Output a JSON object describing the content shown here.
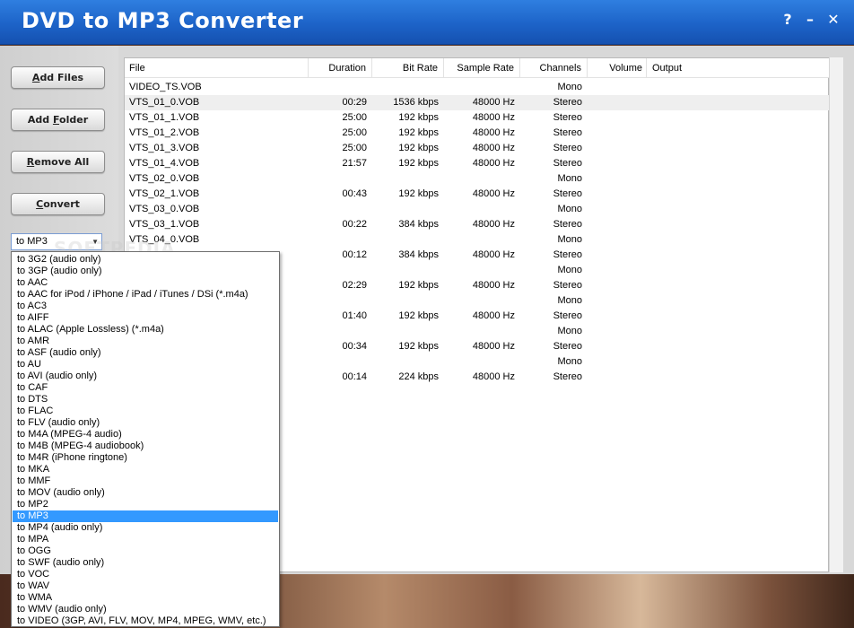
{
  "window": {
    "title": "DVD to MP3 Converter",
    "help_btn": "?",
    "min_btn": "–",
    "close_btn": "✕"
  },
  "sidebar": {
    "add_files_pre": "",
    "add_files_u": "A",
    "add_files_post": "dd Files",
    "add_folder_pre": "Add ",
    "add_folder_u": "F",
    "add_folder_post": "older",
    "remove_all_pre": "",
    "remove_all_u": "R",
    "remove_all_post": "emove All",
    "convert_pre": "",
    "convert_u": "C",
    "convert_post": "onvert",
    "format_value": "to MP3"
  },
  "watermark": "SOFTPEDIA",
  "table": {
    "headers": [
      "File",
      "Duration",
      "Bit Rate",
      "Sample Rate",
      "Channels",
      "Volume",
      "Output"
    ],
    "rows": [
      {
        "file": "VIDEO_TS.VOB",
        "duration": "",
        "bitrate": "",
        "samplerate": "",
        "channels": "Mono"
      },
      {
        "file": "VTS_01_0.VOB",
        "duration": "00:29",
        "bitrate": "1536 kbps",
        "samplerate": "48000 Hz",
        "channels": "Stereo"
      },
      {
        "file": "VTS_01_1.VOB",
        "duration": "25:00",
        "bitrate": "192 kbps",
        "samplerate": "48000 Hz",
        "channels": "Stereo"
      },
      {
        "file": "VTS_01_2.VOB",
        "duration": "25:00",
        "bitrate": "192 kbps",
        "samplerate": "48000 Hz",
        "channels": "Stereo"
      },
      {
        "file": "VTS_01_3.VOB",
        "duration": "25:00",
        "bitrate": "192 kbps",
        "samplerate": "48000 Hz",
        "channels": "Stereo"
      },
      {
        "file": "VTS_01_4.VOB",
        "duration": "21:57",
        "bitrate": "192 kbps",
        "samplerate": "48000 Hz",
        "channels": "Stereo"
      },
      {
        "file": "VTS_02_0.VOB",
        "duration": "",
        "bitrate": "",
        "samplerate": "",
        "channels": "Mono"
      },
      {
        "file": "VTS_02_1.VOB",
        "duration": "00:43",
        "bitrate": "192 kbps",
        "samplerate": "48000 Hz",
        "channels": "Stereo"
      },
      {
        "file": "VTS_03_0.VOB",
        "duration": "",
        "bitrate": "",
        "samplerate": "",
        "channels": "Mono"
      },
      {
        "file": "VTS_03_1.VOB",
        "duration": "00:22",
        "bitrate": "384 kbps",
        "samplerate": "48000 Hz",
        "channels": "Stereo"
      },
      {
        "file": "VTS_04_0.VOB",
        "duration": "",
        "bitrate": "",
        "samplerate": "",
        "channels": "Mono"
      },
      {
        "file": "",
        "duration": "00:12",
        "bitrate": "384 kbps",
        "samplerate": "48000 Hz",
        "channels": "Stereo"
      },
      {
        "file": "",
        "duration": "",
        "bitrate": "",
        "samplerate": "",
        "channels": "Mono"
      },
      {
        "file": "",
        "duration": "02:29",
        "bitrate": "192 kbps",
        "samplerate": "48000 Hz",
        "channels": "Stereo"
      },
      {
        "file": "",
        "duration": "",
        "bitrate": "",
        "samplerate": "",
        "channels": "Mono"
      },
      {
        "file": "",
        "duration": "01:40",
        "bitrate": "192 kbps",
        "samplerate": "48000 Hz",
        "channels": "Stereo"
      },
      {
        "file": "",
        "duration": "",
        "bitrate": "",
        "samplerate": "",
        "channels": "Mono"
      },
      {
        "file": "",
        "duration": "00:34",
        "bitrate": "192 kbps",
        "samplerate": "48000 Hz",
        "channels": "Stereo"
      },
      {
        "file": "",
        "duration": "",
        "bitrate": "",
        "samplerate": "",
        "channels": "Mono"
      },
      {
        "file": "",
        "duration": "00:14",
        "bitrate": "224 kbps",
        "samplerate": "48000 Hz",
        "channels": "Stereo"
      }
    ]
  },
  "format_options": [
    "to 3G2 (audio only)",
    "to 3GP (audio only)",
    "to AAC",
    "to AAC for iPod / iPhone / iPad / iTunes / DSi (*.m4a)",
    "to AC3",
    "to AIFF",
    "to ALAC (Apple Lossless) (*.m4a)",
    "to AMR",
    "to ASF (audio only)",
    "to AU",
    "to AVI (audio only)",
    "to CAF",
    "to DTS",
    "to FLAC",
    "to FLV (audio only)",
    "to M4A (MPEG-4 audio)",
    "to M4B (MPEG-4 audiobook)",
    "to M4R (iPhone ringtone)",
    "to MKA",
    "to MMF",
    "to MOV (audio only)",
    "to MP2",
    "to MP3",
    "to MP4 (audio only)",
    "to MPA",
    "to OGG",
    "to SWF (audio only)",
    "to VOC",
    "to WAV",
    "to WMA",
    "to WMV (audio only)",
    "to VIDEO (3GP, AVI, FLV, MOV, MP4, MPEG, WMV, etc.)"
  ],
  "selected_format": "to MP3",
  "colors": {
    "title_bar": "#1d63c8",
    "selection": "#3399ff"
  }
}
